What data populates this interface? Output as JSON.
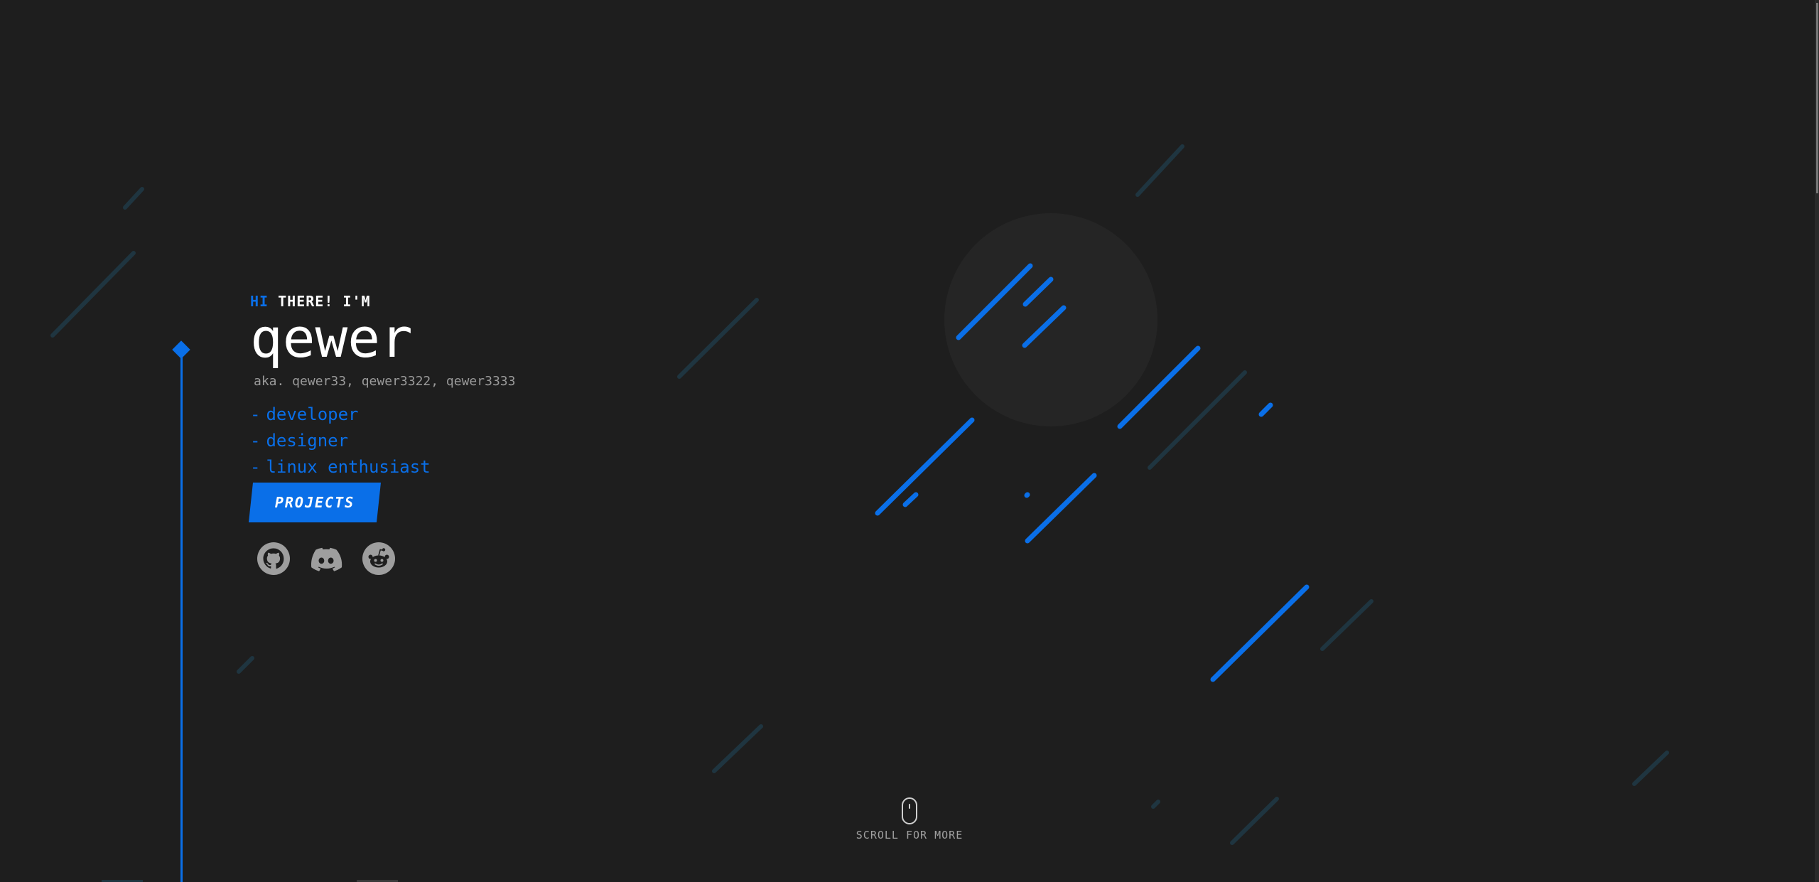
{
  "hero": {
    "greeting_hi": "HI",
    "greeting_rest": "THERE! I'M",
    "name": "qewer",
    "aka": "aka. qewer33, qewer3322, qewer3333",
    "roles": [
      {
        "dash": "-",
        "label": "developer"
      },
      {
        "dash": "-",
        "label": "designer"
      },
      {
        "dash": "-",
        "label": "linux enthusiast"
      }
    ],
    "cta_label": "PROJECTS"
  },
  "socials": [
    {
      "icon": "github-icon"
    },
    {
      "icon": "discord-icon"
    },
    {
      "icon": "reddit-icon"
    }
  ],
  "scroll_hint": {
    "label": "SCROLL FOR MORE",
    "icon": "mouse-icon"
  },
  "colors": {
    "background": "#1e1e1e",
    "accent": "#0a6fe8",
    "dim_line": "#1f3540",
    "text": "#ffffff",
    "muted": "#9a9a9a",
    "icon": "#9e9e9e"
  }
}
